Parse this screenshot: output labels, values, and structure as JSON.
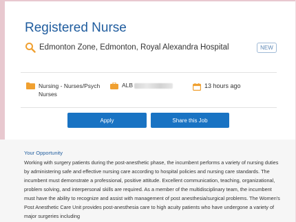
{
  "job": {
    "title": "Registered Nurse",
    "location": "Edmonton Zone, Edmonton, Royal Alexandra Hospital",
    "badge": "NEW"
  },
  "meta": {
    "category": "Nursing - Nurses/Psych Nurses",
    "job_id_prefix": "ALB",
    "posted": "13 hours ago"
  },
  "actions": {
    "apply": "Apply",
    "share": "Share this Job"
  },
  "description": {
    "heading": "Your Opportunity",
    "text": "Working with surgery patients during the post-anesthetic phase, the incumbent performs a variety of nursing duties by administering safe and effective nursing care according to hospital policies and nursing care standards. The incumbent must demonstrate a professional, positive attitude. Excellent communication, teaching, organizational, problem solving, and interpersonal skills are required. As a member of the multidisciplinary team, the incumbent must have the ability to recognize and assist with management of post anesthesia/surgical problems. The Women's Post Anesthetic Care Unit provides post-anesthesia care to high acuity patients who have undergone a variety of major surgeries including"
  },
  "icons": {
    "location": "search-pin-icon",
    "category": "folder-icon",
    "job_id": "briefcase-icon",
    "posted": "calendar-icon"
  },
  "colors": {
    "accent": "#1973c3",
    "title": "#1f5c9e",
    "icon_orange": "#f0a030"
  }
}
